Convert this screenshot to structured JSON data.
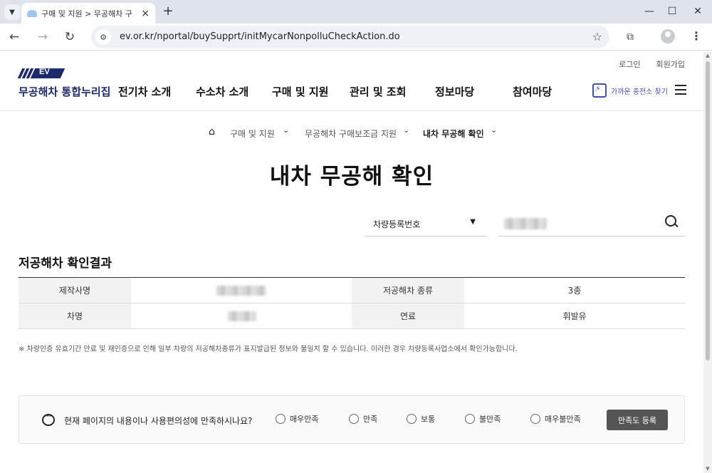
{
  "browser": {
    "tab_title": "구매 및 지원 > 무공해차 구",
    "url": "ev.or.kr/nportal/buySupprt/initMycarNonpolluCheckAction.do",
    "new_tab_symbol": "+",
    "close_symbol": "×",
    "window": {
      "minimize": "—",
      "maximize": "☐",
      "close": "✕"
    },
    "nav": {
      "back": "←",
      "forward": "→",
      "reload": "↻"
    },
    "icons": {
      "site_info": "tune-icon",
      "bookmark": "star-icon",
      "extensions": "puzzle-icon",
      "profile": "avatar-icon",
      "menu": "kebab-menu-icon"
    }
  },
  "header": {
    "util_links": [
      "로그인",
      "회원가입"
    ],
    "logo_badge": "EV",
    "logo_text": "무공해차 통합누리집",
    "gnb": [
      "전기차 소개",
      "수소차 소개",
      "구매 및 지원",
      "관리 및 조회",
      "정보마당",
      "참여마당"
    ],
    "charger_link": "가까운 충전소 찾기"
  },
  "breadcrumb": {
    "items": [
      "구매 및 지원",
      "무공해차 구매보조금 지원",
      "내차 무공해 확인"
    ],
    "chevron": "⌄"
  },
  "page_title": "내차 무공해 확인",
  "search": {
    "select_label": "차량등록번호",
    "select_arrow": "▼",
    "input_value_redacted": true
  },
  "result": {
    "section_title": "저공해차 확인결과",
    "rows": [
      {
        "label1": "제작사명",
        "value1": "",
        "label2": "저공해차 종류",
        "value2": "3종"
      },
      {
        "label1": "차명",
        "value1": "",
        "label2": "연료",
        "value2": "휘발유"
      }
    ],
    "notice": "※ 차량인증 유효기간 만료 및 재인증으로 인해 일부 차량의 저공해차종류가 표지발급된 정보와 불일치 할 수 있습니다. 이러한 경우 차량등록사업소에서 확인가능합니다."
  },
  "survey": {
    "question": "현재 페이지의 내용이나 사용편의성에 만족하시나요?",
    "options": [
      "매우만족",
      "만족",
      "보통",
      "불만족",
      "매우불만족"
    ],
    "submit_label": "만족도 등록"
  }
}
